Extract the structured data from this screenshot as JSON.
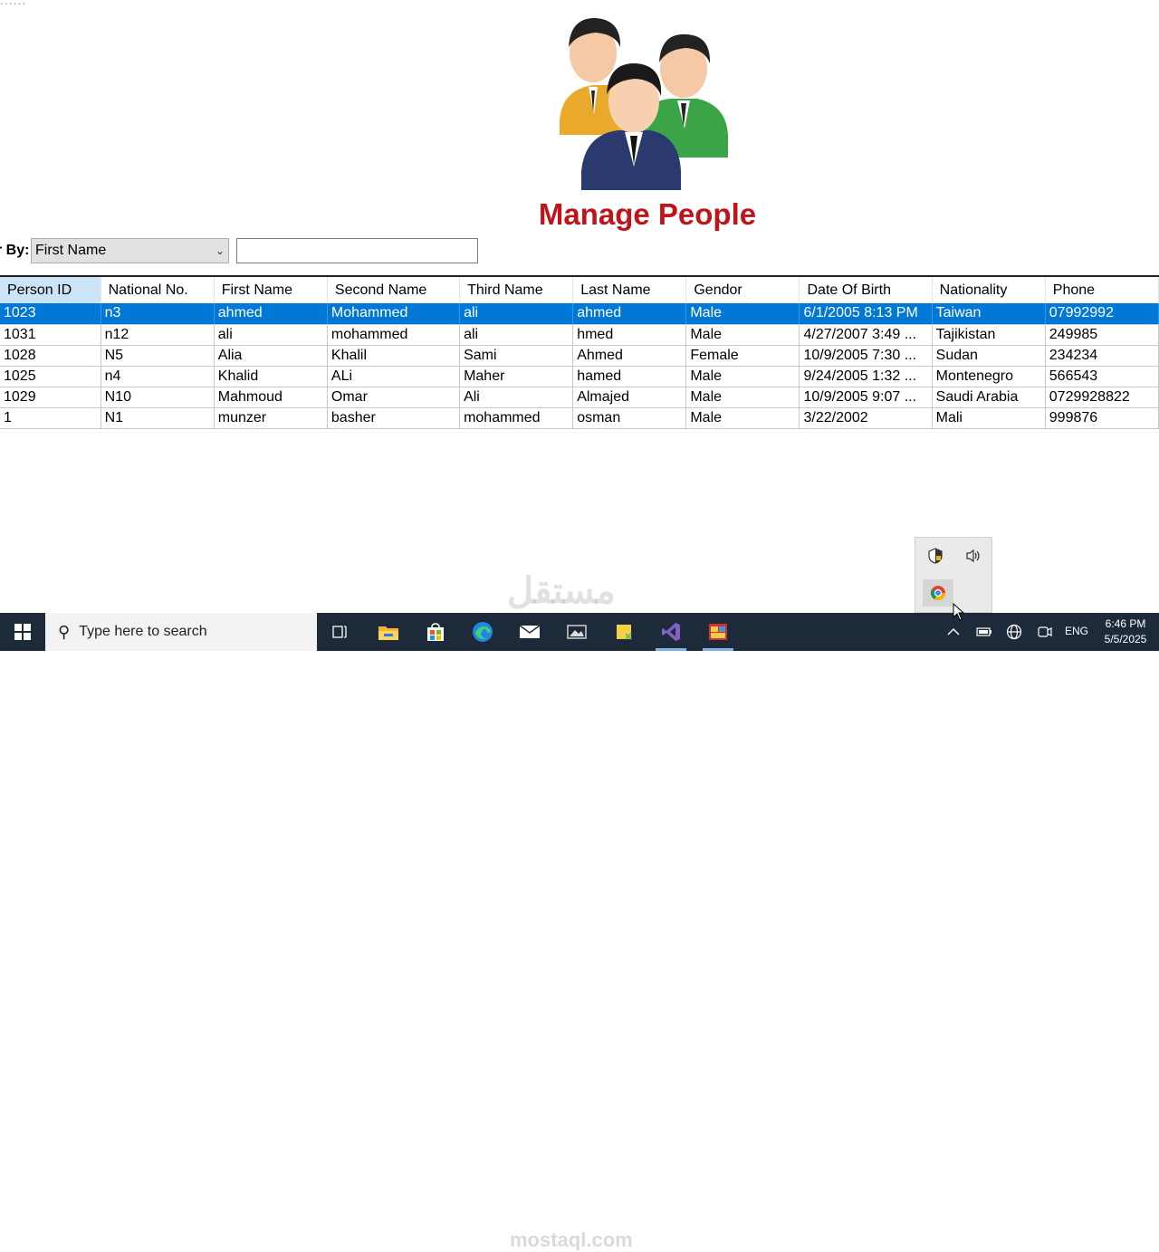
{
  "top_cut_text": "......",
  "title": "Manage People",
  "filter": {
    "label": "r By:",
    "selected": "First Name",
    "search_value": ""
  },
  "table": {
    "columns": [
      "Person ID",
      "National No.",
      "First Name",
      "Second Name",
      "Third Name",
      "Last Name",
      "Gendor",
      "Date Of Birth",
      "Nationality",
      "Phone"
    ],
    "rows": [
      [
        "1023",
        "n3",
        "ahmed",
        "Mohammed",
        "ali",
        "ahmed",
        "Male",
        "6/1/2005 8:13 PM",
        "Taiwan",
        "07992992"
      ],
      [
        "1031",
        "n12",
        "ali",
        "mohammed",
        "ali",
        "hmed",
        "Male",
        "4/27/2007 3:49 ...",
        "Tajikistan",
        "249985"
      ],
      [
        "1028",
        "N5",
        "Alia",
        "Khalil",
        "Sami",
        "Ahmed",
        "Female",
        "10/9/2005 7:30 ...",
        "Sudan",
        "234234"
      ],
      [
        "1025",
        "n4",
        "Khalid",
        "ALi",
        "Maher",
        "hamed",
        "Male",
        "9/24/2005 1:32 ...",
        "Montenegro",
        "566543"
      ],
      [
        "1029",
        "N10",
        "Mahmoud",
        "Omar",
        "Ali",
        "Almajed",
        "Male",
        "10/9/2005 9:07 ...",
        "Saudi Arabia",
        "0729928822"
      ],
      [
        "1",
        "N1",
        "munzer",
        "basher",
        "mohammed",
        "osman",
        "Male",
        "3/22/2002",
        "Mali",
        "999876"
      ]
    ],
    "selected_row": 0
  },
  "watermark": {
    "arabic": "مستقل",
    "latin": "mostaql.com"
  },
  "taskbar": {
    "search_placeholder": "Type here to search",
    "language": "ENG",
    "time": "6:46 PM",
    "date": "5/5/2025",
    "apps": [
      "task-view-icon",
      "file-explorer-icon",
      "store-icon",
      "edge-icon",
      "mail-icon",
      "photos-icon",
      "sticky-icon",
      "visual-studio-icon",
      "winforms-app-icon"
    ]
  },
  "colors": {
    "title": "#c0141b",
    "selection": "#0078d7",
    "taskbar": "#1c2a3a"
  }
}
